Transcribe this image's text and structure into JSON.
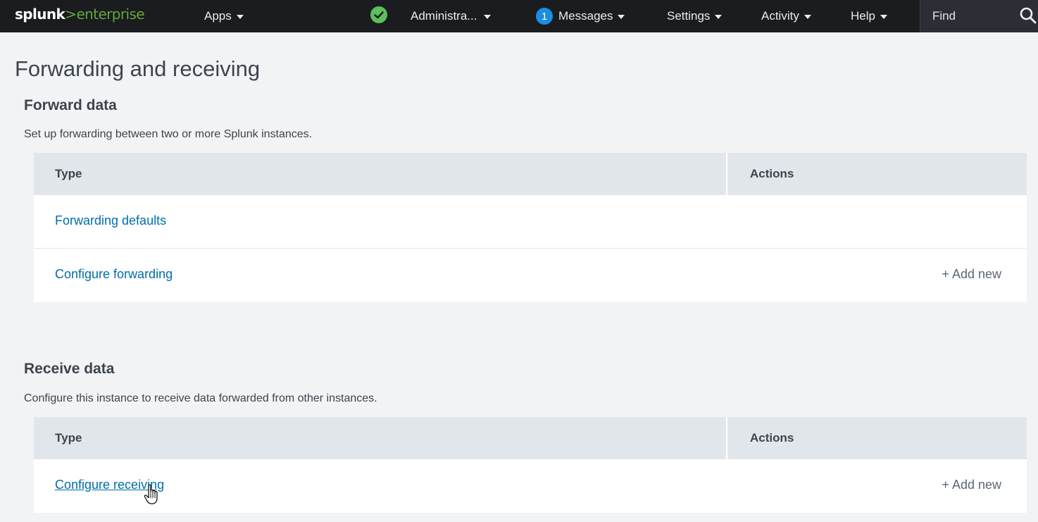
{
  "header": {
    "logo": {
      "part1": "splunk",
      "part2": ">",
      "part3": "enterprise"
    },
    "apps_label": "Apps",
    "status_icon": "check-circle-icon",
    "admin_label": "Administra...",
    "messages_badge": "1",
    "messages_label": "Messages",
    "settings_label": "Settings",
    "activity_label": "Activity",
    "help_label": "Help",
    "find_label": "Find",
    "colors": {
      "bar": "#1a1c20",
      "brand": "#65a637",
      "status_ok": "#5cc05c",
      "badge": "#1a8fe0"
    }
  },
  "page": {
    "title": "Forwarding and receiving",
    "link_color": "#006eaa"
  },
  "forward": {
    "title": "Forward data",
    "description": "Set up forwarding between two or more Splunk instances.",
    "columns": {
      "type": "Type",
      "actions": "Actions"
    },
    "rows": [
      {
        "type": "Forwarding defaults",
        "action": ""
      },
      {
        "type": "Configure forwarding",
        "action": "+ Add new"
      }
    ]
  },
  "receive": {
    "title": "Receive data",
    "description": "Configure this instance to receive data forwarded from other instances.",
    "columns": {
      "type": "Type",
      "actions": "Actions"
    },
    "rows": [
      {
        "type": "Configure receiving",
        "action": "+ Add new"
      }
    ]
  }
}
